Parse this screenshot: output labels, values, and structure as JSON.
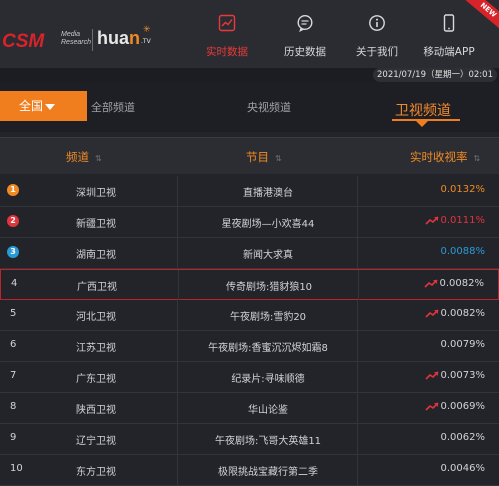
{
  "header": {
    "logo_csm": "CSM",
    "logo_sub": "Media Research",
    "logo_huan_a": "hua",
    "logo_huan_b": "n",
    "logo_tv": ".TV",
    "ribbon": "NEW",
    "nav": [
      {
        "label": "实时数据",
        "icon": "chart-icon",
        "active": true
      },
      {
        "label": "历史数据",
        "icon": "chat-bubble-icon",
        "active": false
      },
      {
        "label": "关于我们",
        "icon": "info-icon",
        "active": false
      },
      {
        "label": "移动端APP",
        "icon": "phone-icon",
        "active": false
      }
    ]
  },
  "date": "2021/07/19（星期一）02:01",
  "tabs": {
    "active": "全国",
    "items": [
      "全部频道",
      "央视频道"
    ],
    "current": "卫视频道"
  },
  "table": {
    "headers": {
      "channel": "频道",
      "program": "节目",
      "rating": "实时收视率"
    },
    "rows": [
      {
        "rank": "1",
        "channel": "深圳卫视",
        "program": "直播港澳台",
        "rating": "0.0132%",
        "trend": false,
        "badge": "orange",
        "color": "#f08a24"
      },
      {
        "rank": "2",
        "channel": "新疆卫视",
        "program": "星夜剧场—小欢喜44",
        "rating": "0.0111%",
        "trend": true,
        "badge": "red",
        "color": "#e0353c"
      },
      {
        "rank": "3",
        "channel": "湖南卫视",
        "program": "新闻大求真",
        "rating": "0.0088%",
        "trend": false,
        "badge": "blue",
        "color": "#2a9ad6"
      },
      {
        "rank": "4",
        "channel": "广西卫视",
        "program": "传奇剧场:猎豺狼10",
        "rating": "0.0082%",
        "trend": true,
        "badge": "",
        "color": "#d2d3d7"
      },
      {
        "rank": "5",
        "channel": "河北卫视",
        "program": "午夜剧场:雪豹20",
        "rating": "0.0082%",
        "trend": true,
        "badge": "",
        "color": "#d2d3d7"
      },
      {
        "rank": "6",
        "channel": "江苏卫视",
        "program": "午夜剧场:香蜜沉沉烬如霜8",
        "rating": "0.0079%",
        "trend": false,
        "badge": "",
        "color": "#d2d3d7"
      },
      {
        "rank": "7",
        "channel": "广东卫视",
        "program": "纪录片:寻味顺德",
        "rating": "0.0073%",
        "trend": true,
        "badge": "",
        "color": "#d2d3d7"
      },
      {
        "rank": "8",
        "channel": "陕西卫视",
        "program": "华山论鉴",
        "rating": "0.0069%",
        "trend": true,
        "badge": "",
        "color": "#d2d3d7"
      },
      {
        "rank": "9",
        "channel": "辽宁卫视",
        "program": "午夜剧场:飞哥大英雄11",
        "rating": "0.0062%",
        "trend": false,
        "badge": "",
        "color": "#d2d3d7"
      },
      {
        "rank": "10",
        "channel": "东方卫视",
        "program": "极限挑战宝藏行第二季",
        "rating": "0.0046%",
        "trend": false,
        "badge": "",
        "color": "#d2d3d7"
      }
    ]
  },
  "colors": {
    "accent": "#f07d1e",
    "active_nav": "#e83a3a",
    "trend": "#e0353c",
    "highlight_border": "#b8262b"
  }
}
